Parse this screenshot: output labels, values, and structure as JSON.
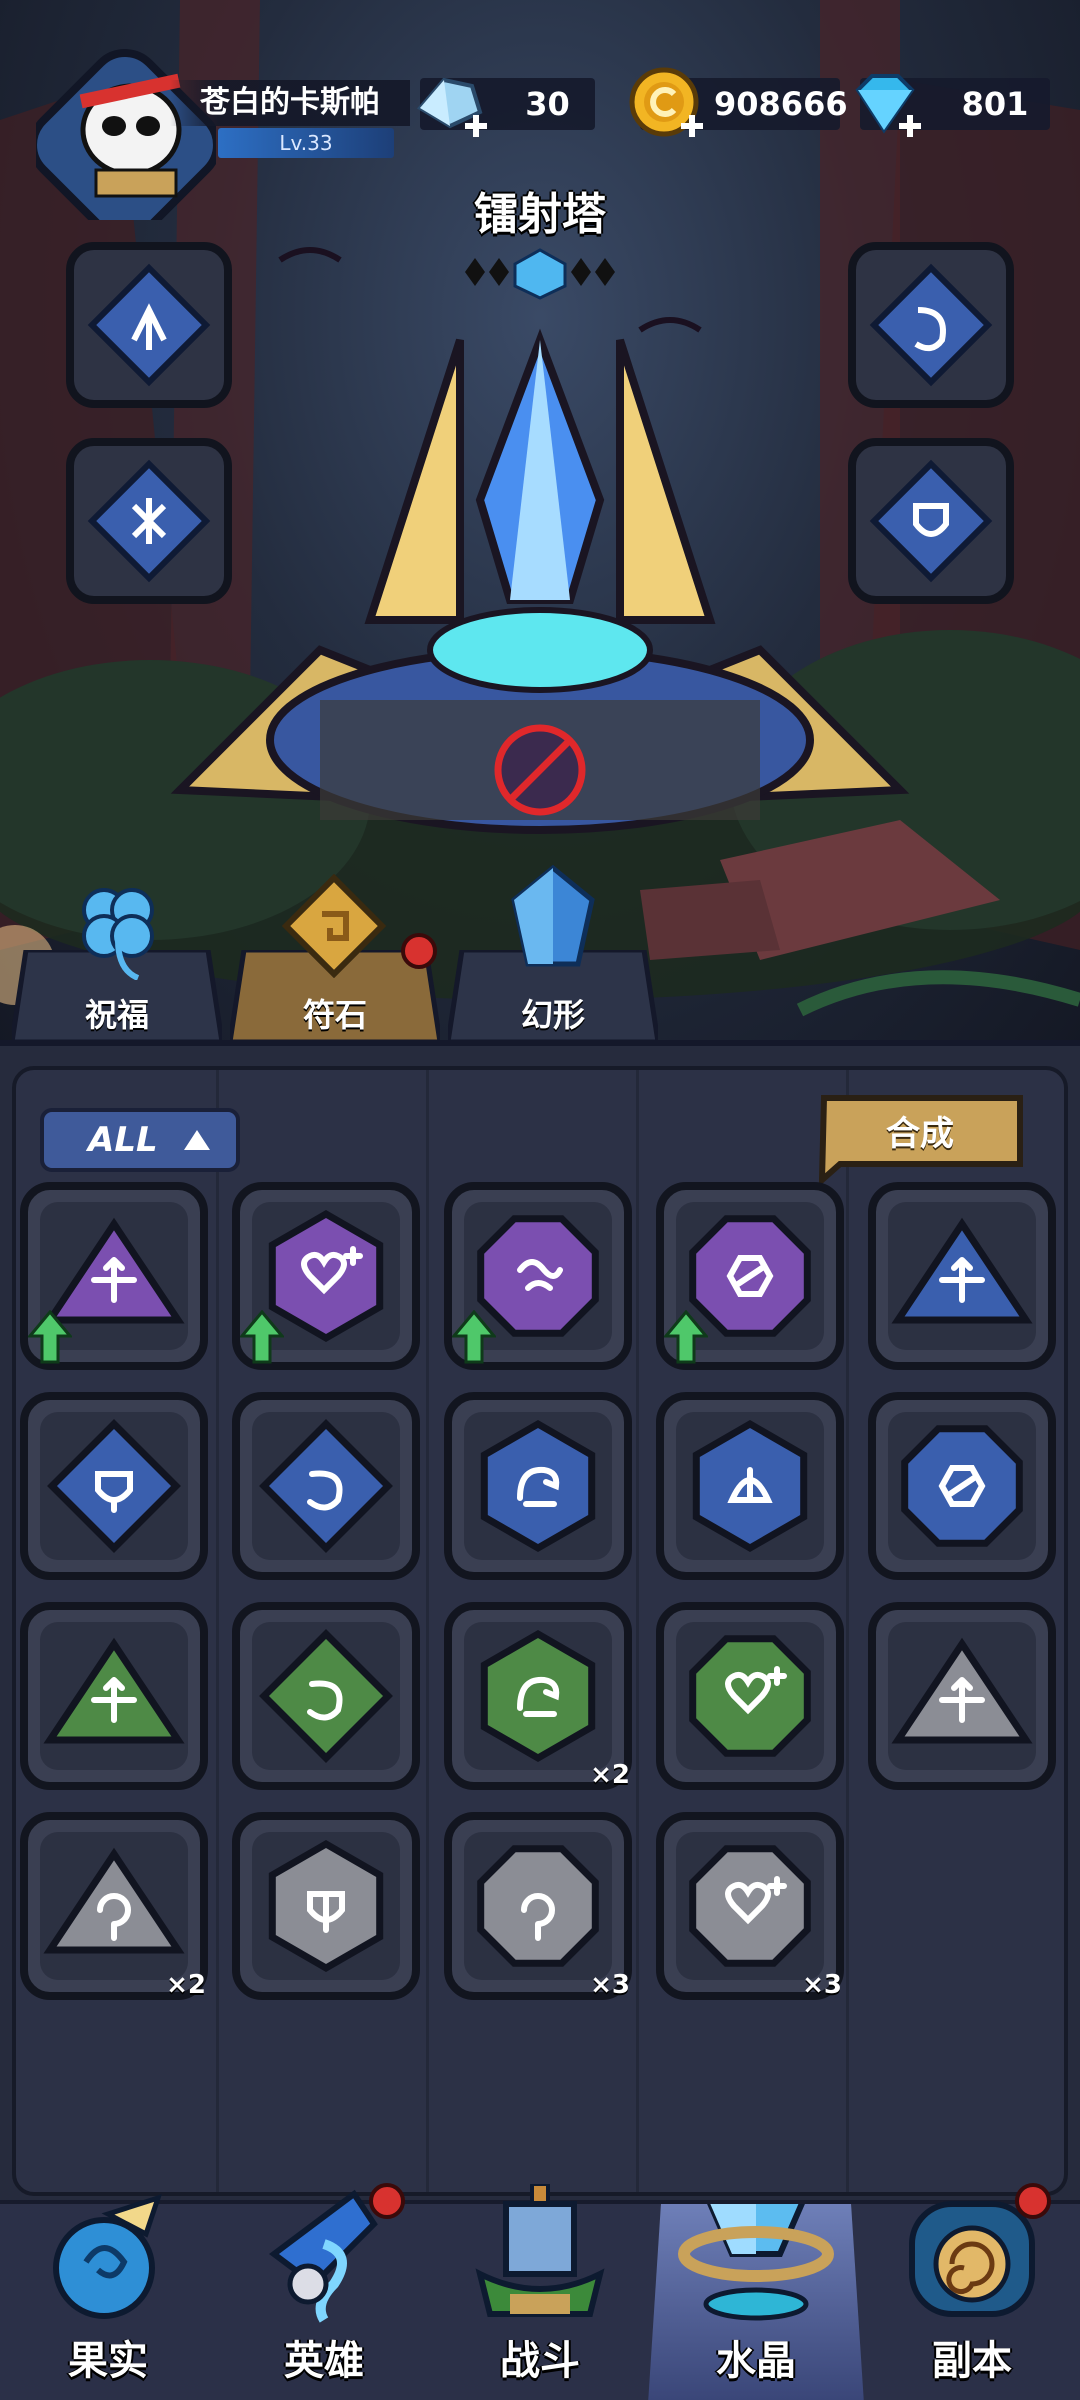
{
  "player": {
    "name": "苍白的卡斯帕",
    "level": "Lv.33"
  },
  "resources": [
    {
      "name": "crystal-shards",
      "icon": "crystal-shard-icon",
      "value": "30"
    },
    {
      "name": "gold",
      "icon": "gold-coin-icon",
      "value": "908666"
    },
    {
      "name": "diamonds",
      "icon": "diamond-icon",
      "value": "801"
    }
  ],
  "tower": {
    "name": "镭射塔"
  },
  "side_slots": [
    {
      "side": "left",
      "icon": "arrow-rune-icon"
    },
    {
      "side": "left",
      "icon": "burst-rune-icon"
    },
    {
      "side": "right",
      "icon": "curl-rune-icon"
    },
    {
      "side": "right",
      "icon": "shield-rune-icon"
    }
  ],
  "tabs": [
    {
      "label": "祝福",
      "icon": "clover-icon",
      "active": false,
      "badge": false
    },
    {
      "label": "符石",
      "icon": "runestone-icon",
      "active": true,
      "badge": true
    },
    {
      "label": "幻形",
      "icon": "crystal-form-icon",
      "active": false,
      "badge": false
    }
  ],
  "inventory": {
    "filter_label": "ALL",
    "combine_label": "合成",
    "items": [
      {
        "shape": "triangle",
        "color": "#7b4fb0",
        "icon": "spread-arrows-icon",
        "upgrade": true,
        "count": ""
      },
      {
        "shape": "hexagon",
        "color": "#7b4fb0",
        "icon": "heart-plus-icon",
        "upgrade": true,
        "count": ""
      },
      {
        "shape": "octagon",
        "color": "#7b4fb0",
        "icon": "wave-icon",
        "upgrade": true,
        "count": ""
      },
      {
        "shape": "octagon",
        "color": "#7b4fb0",
        "icon": "slash-hex-icon",
        "upgrade": true,
        "count": ""
      },
      {
        "shape": "triangle",
        "color": "#3a5fae",
        "icon": "spread-arrows-icon",
        "upgrade": false,
        "count": ""
      },
      {
        "shape": "diamond",
        "color": "#3a5fae",
        "icon": "shield-up-icon",
        "upgrade": false,
        "count": ""
      },
      {
        "shape": "diamond",
        "color": "#3a5fae",
        "icon": "curl-arrow-icon",
        "upgrade": false,
        "count": ""
      },
      {
        "shape": "hexagon",
        "color": "#3a5fae",
        "icon": "dragon-icon",
        "upgrade": false,
        "count": ""
      },
      {
        "shape": "hexagon",
        "color": "#3a5fae",
        "icon": "shell-icon",
        "upgrade": false,
        "count": ""
      },
      {
        "shape": "octagon",
        "color": "#3a5fae",
        "icon": "slash-hex-icon",
        "upgrade": false,
        "count": ""
      },
      {
        "shape": "triangle",
        "color": "#4e8a46",
        "icon": "spread-arrows-icon",
        "upgrade": false,
        "count": ""
      },
      {
        "shape": "diamond",
        "color": "#4e8a46",
        "icon": "curl-arrow-icon",
        "upgrade": false,
        "count": ""
      },
      {
        "shape": "hexagon",
        "color": "#4e8a46",
        "icon": "dragon-icon",
        "upgrade": false,
        "count": "×2"
      },
      {
        "shape": "octagon",
        "color": "#4e8a46",
        "icon": "heart-plus-icon",
        "upgrade": false,
        "count": ""
      },
      {
        "shape": "triangle",
        "color": "#8b8d95",
        "icon": "spread-arrows-icon",
        "upgrade": false,
        "count": ""
      },
      {
        "shape": "triangle",
        "color": "#8b8d95",
        "icon": "swirl-icon",
        "upgrade": false,
        "count": "×2"
      },
      {
        "shape": "hexagon",
        "color": "#8b8d95",
        "icon": "split-shield-icon",
        "upgrade": false,
        "count": ""
      },
      {
        "shape": "octagon",
        "color": "#8b8d95",
        "icon": "swirl-icon",
        "upgrade": false,
        "count": "×3"
      },
      {
        "shape": "octagon",
        "color": "#8b8d95",
        "icon": "heart-plus-icon",
        "upgrade": false,
        "count": "×3"
      }
    ]
  },
  "nav": [
    {
      "label": "果实",
      "icon": "fruit-icon",
      "active": false,
      "badge": false
    },
    {
      "label": "英雄",
      "icon": "hero-icon",
      "active": false,
      "badge": true
    },
    {
      "label": "战斗",
      "icon": "battle-icon",
      "active": false,
      "badge": false
    },
    {
      "label": "水晶",
      "icon": "crystal-icon",
      "active": true,
      "badge": true
    },
    {
      "label": "副本",
      "icon": "dungeon-icon",
      "active": false,
      "badge": true
    }
  ],
  "colors": {
    "accent_gold": "#c9a25a",
    "panel": "#2c3146",
    "badge_red": "#d8322f",
    "upgrade_green": "#4fc86a"
  }
}
